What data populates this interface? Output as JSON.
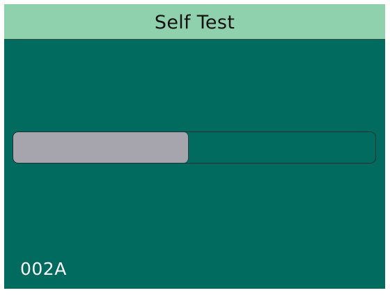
{
  "header": {
    "title": "Self Test"
  },
  "progress": {
    "fraction": 0.485
  },
  "status": {
    "code": "002A"
  },
  "colors": {
    "background": "#006b5e",
    "header": "#90d1ad",
    "progress_fill": "#a6a5ae",
    "text_light": "#ffffff",
    "text_dark": "#111111"
  }
}
